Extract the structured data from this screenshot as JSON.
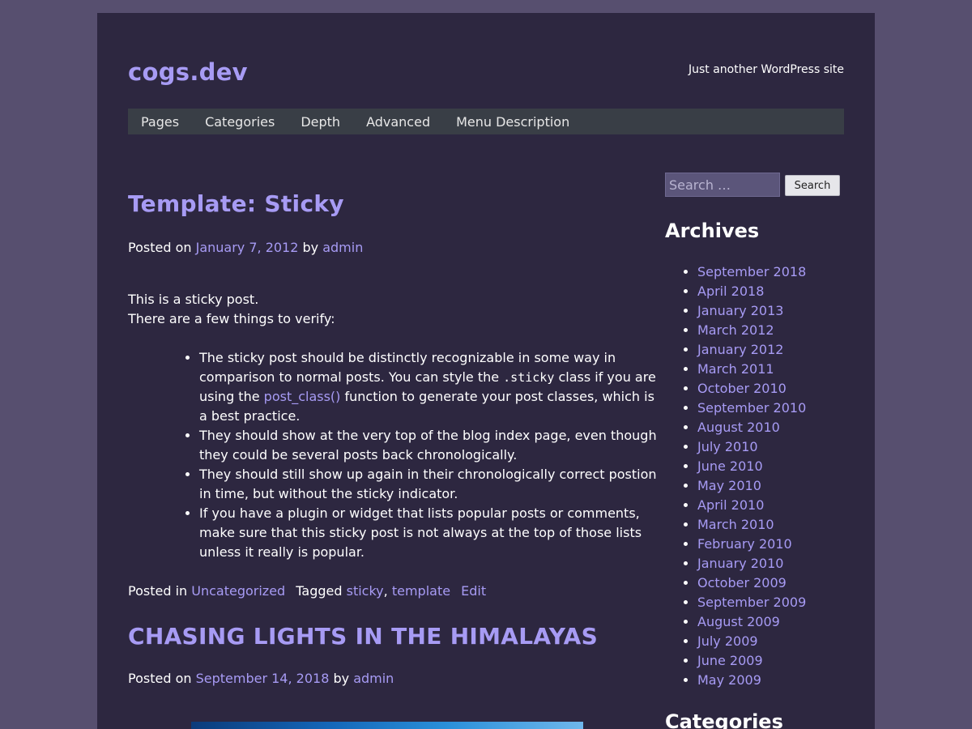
{
  "site": {
    "title": "cogs.dev",
    "description": "Just another WordPress site"
  },
  "nav": {
    "items": [
      "Pages",
      "Categories",
      "Depth",
      "Advanced",
      "Menu Description"
    ]
  },
  "posts": [
    {
      "title": "Template: Sticky",
      "posted_on_label": "Posted on",
      "date": "January 7, 2012",
      "by_label": "by",
      "author": "admin",
      "intro_line1": "This is a sticky post.",
      "intro_line2": "There are a few things to verify:",
      "bullets": [
        {
          "part1": "The sticky post should be distinctly recognizable in some way in comparison to normal posts. You can style the ",
          "code": ".sticky",
          "part2": " class if you are using the ",
          "link": "post_class()",
          "part3": " function to generate your post classes, which is a best practice."
        },
        {
          "text": "They should show at the very top of the blog index page, even though they could be several posts back chronologically."
        },
        {
          "text": "They should still show up again in their chronologically correct postion in time, but without the sticky indicator."
        },
        {
          "text": "If you have a plugin or widget that lists popular posts or comments, make sure that this sticky post is not always at the top of those lists unless it really is popular."
        }
      ],
      "footer": {
        "posted_in_label": "Posted in",
        "category": "Uncategorized",
        "tagged_label": "Tagged",
        "tag1": "sticky",
        "tag2": "template",
        "edit_label": "Edit"
      }
    },
    {
      "title": "CHASING LIGHTS IN THE HIMALAYAS",
      "posted_on_label": "Posted on",
      "date": "September 14, 2018",
      "by_label": "by",
      "author": "admin"
    }
  ],
  "sidebar": {
    "search": {
      "placeholder": "Search …",
      "button_label": "Search"
    },
    "archives_title": "Archives",
    "archives": [
      "September 2018",
      "April 2018",
      "January 2013",
      "March 2012",
      "January 2012",
      "March 2011",
      "October 2010",
      "September 2010",
      "August 2010",
      "July 2010",
      "June 2010",
      "May 2010",
      "April 2010",
      "March 2010",
      "February 2010",
      "January 2010",
      "October 2009",
      "September 2009",
      "August 2009",
      "July 2009",
      "June 2009",
      "May 2009"
    ],
    "categories_title": "Categories"
  },
  "colors": {
    "background": "#574f6f",
    "page": "#2d2740",
    "accent_link": "#a79bf4",
    "nav_bar": "#393e46"
  }
}
